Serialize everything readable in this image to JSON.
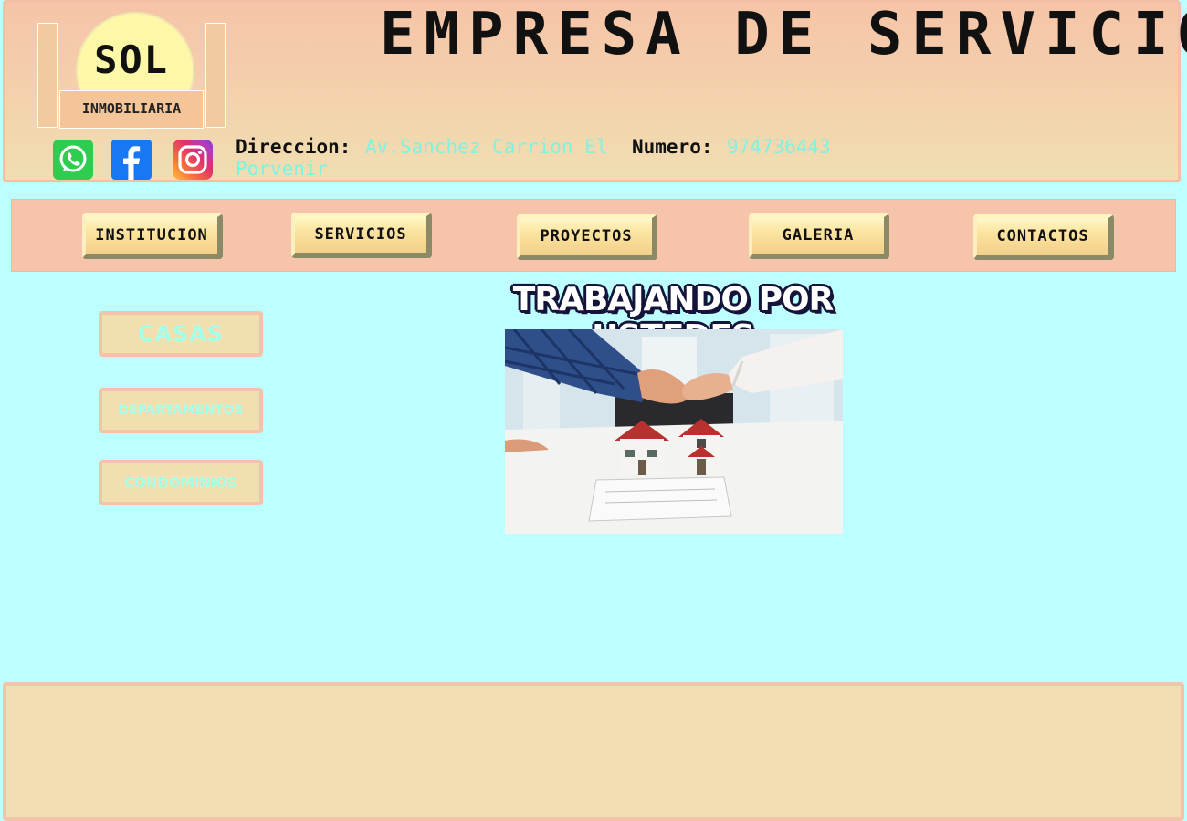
{
  "header": {
    "logo": {
      "name": "SOL",
      "subtitle": "INMOBILIARIA"
    },
    "title": "EMPRESA DE SERVICIO",
    "social": [
      {
        "icon": "whatsapp-icon",
        "color": "#2ecc4f"
      },
      {
        "icon": "facebook-icon",
        "color": "#1877f2"
      },
      {
        "icon": "instagram-icon",
        "color": "#e1306c"
      }
    ],
    "address_label": "Direccion:",
    "address_value": "Av.Sanchez Carrion El Porvenir",
    "phone_label": "Numero:",
    "phone_value": "974736443"
  },
  "nav": {
    "items": [
      {
        "label": "INSTITUCION"
      },
      {
        "label": "SERVICIOS"
      },
      {
        "label": "PROYECTOS"
      },
      {
        "label": "GALERIA"
      },
      {
        "label": "CONTACTOS"
      }
    ]
  },
  "sidebar": {
    "items": [
      {
        "label": "CASAS"
      },
      {
        "label": "DEPARTAMENTOS"
      },
      {
        "label": "CONDOMINIOS"
      }
    ]
  },
  "main": {
    "tagline": "TRABAJANDO POR USTEDES",
    "image_subject": "handshake over house models"
  },
  "colors": {
    "page_background": "#bdffff",
    "header_background": "#f6c4a8",
    "accent_text": "#7ff3e0",
    "footer_background": "#f2deb2"
  }
}
